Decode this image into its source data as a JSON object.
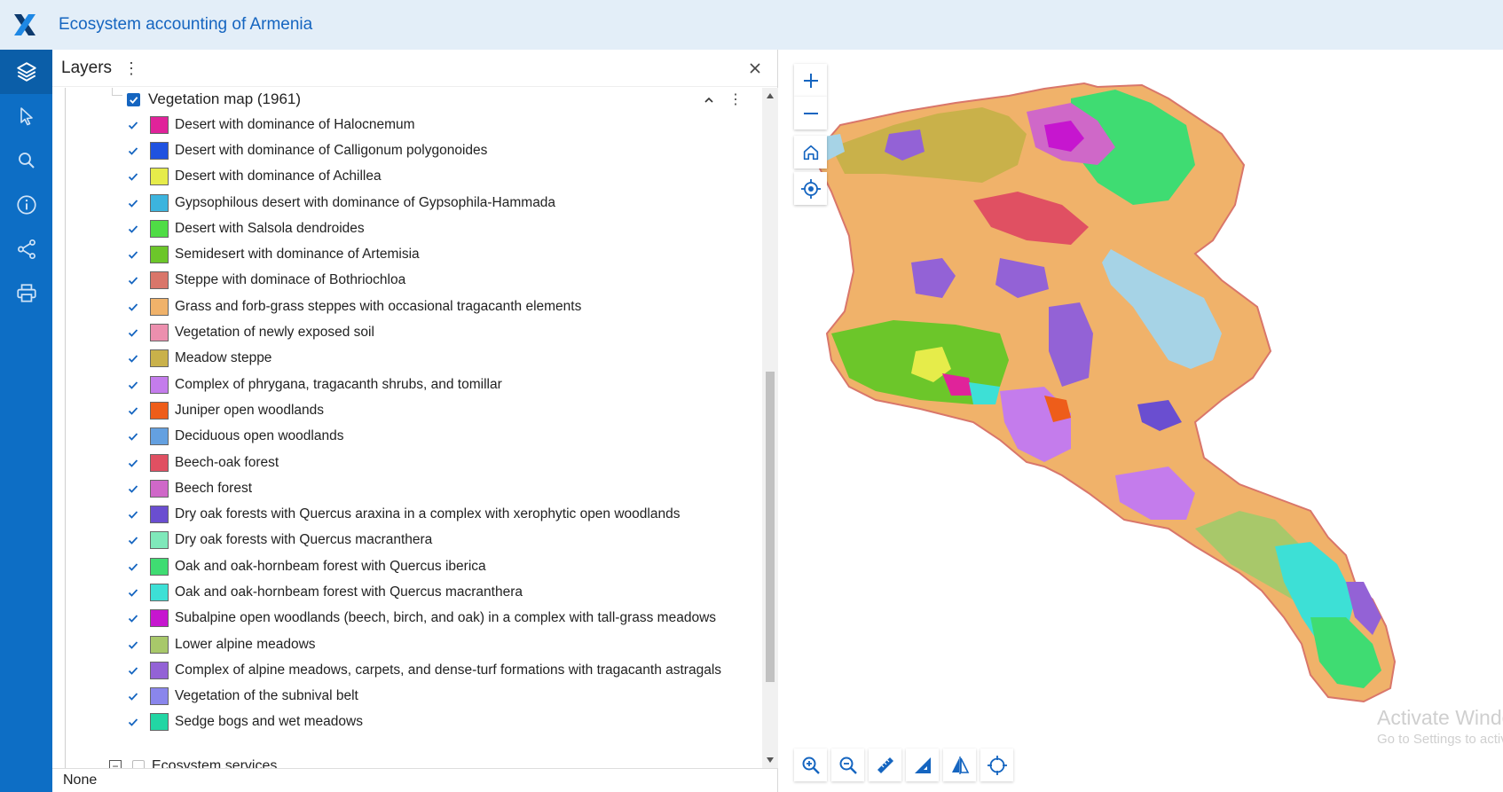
{
  "app": {
    "title": "Ecosystem accounting of Armenia"
  },
  "sidebar": {
    "tools": [
      {
        "name": "layers-icon"
      },
      {
        "name": "select-icon"
      },
      {
        "name": "search-icon"
      },
      {
        "name": "info-icon"
      },
      {
        "name": "share-icon"
      },
      {
        "name": "print-icon"
      }
    ]
  },
  "panel": {
    "title": "Layers",
    "group": {
      "label": "Vegetation map (1961)",
      "checked": true
    },
    "legend": [
      {
        "label": "Desert with dominance of Halocnemum",
        "color": "#e0239a"
      },
      {
        "label": "Desert with dominance of Calligonum polygonoides",
        "color": "#1f52e0"
      },
      {
        "label": "Desert with dominance of Achillea",
        "color": "#e6ec4a"
      },
      {
        "label": "Gypsophilous desert with dominance of Gypsophila-Hammada",
        "color": "#3cb4de"
      },
      {
        "label": "Desert with Salsola dendroides",
        "color": "#4fdc45"
      },
      {
        "label": "Semidesert with dominance of Artemisia",
        "color": "#6cc62a"
      },
      {
        "label": "Steppe with dominace of Bothriochloa",
        "color": "#d9766a"
      },
      {
        "label": "Grass and forb-grass steppes with occasional tragacanth elements",
        "color": "#f0b26a"
      },
      {
        "label": "Vegetation of newly exposed soil",
        "color": "#ec8fae"
      },
      {
        "label": "Meadow steppe",
        "color": "#c9b14a"
      },
      {
        "label": "Complex of phrygana, tragacanth shrubs, and tomillar",
        "color": "#c47cec"
      },
      {
        "label": "Juniper open woodlands",
        "color": "#ee5d1a"
      },
      {
        "label": "Deciduous open woodlands",
        "color": "#64a0e0"
      },
      {
        "label": "Beech-oak forest",
        "color": "#e05062"
      },
      {
        "label": "Beech forest",
        "color": "#cf68c8"
      },
      {
        "label": "Dry oak forests with Quercus araxina in a complex with xerophytic open woodlands",
        "color": "#6a4ed0"
      },
      {
        "label": "Dry oak forests with Quercus macranthera",
        "color": "#7fe8ba"
      },
      {
        "label": "Oak and oak-hornbeam forest with Quercus iberica",
        "color": "#3fdc72"
      },
      {
        "label": "Oak and oak-hornbeam forest with Quercus macranthera",
        "color": "#3de0d6"
      },
      {
        "label": "Subalpine open woodlands (beech, birch, and oak) in a complex with tall-grass meadows",
        "color": "#c616cf"
      },
      {
        "label": "Lower alpine meadows",
        "color": "#a8c86a"
      },
      {
        "label": "Complex of alpine meadows, carpets, and dense-turf formations with tragacanth astragals",
        "color": "#9362d6"
      },
      {
        "label": "Vegetation of the subnival belt",
        "color": "#8a86ec"
      },
      {
        "label": "Sedge bogs and wet meadows",
        "color": "#22d6a4"
      }
    ],
    "next_group": {
      "label": "Ecosystem services"
    },
    "basemap": {
      "label": "None"
    }
  },
  "map": {
    "watermark_line1": "Activate Windows",
    "watermark_line2": "Go to Settings to activate Windows."
  }
}
